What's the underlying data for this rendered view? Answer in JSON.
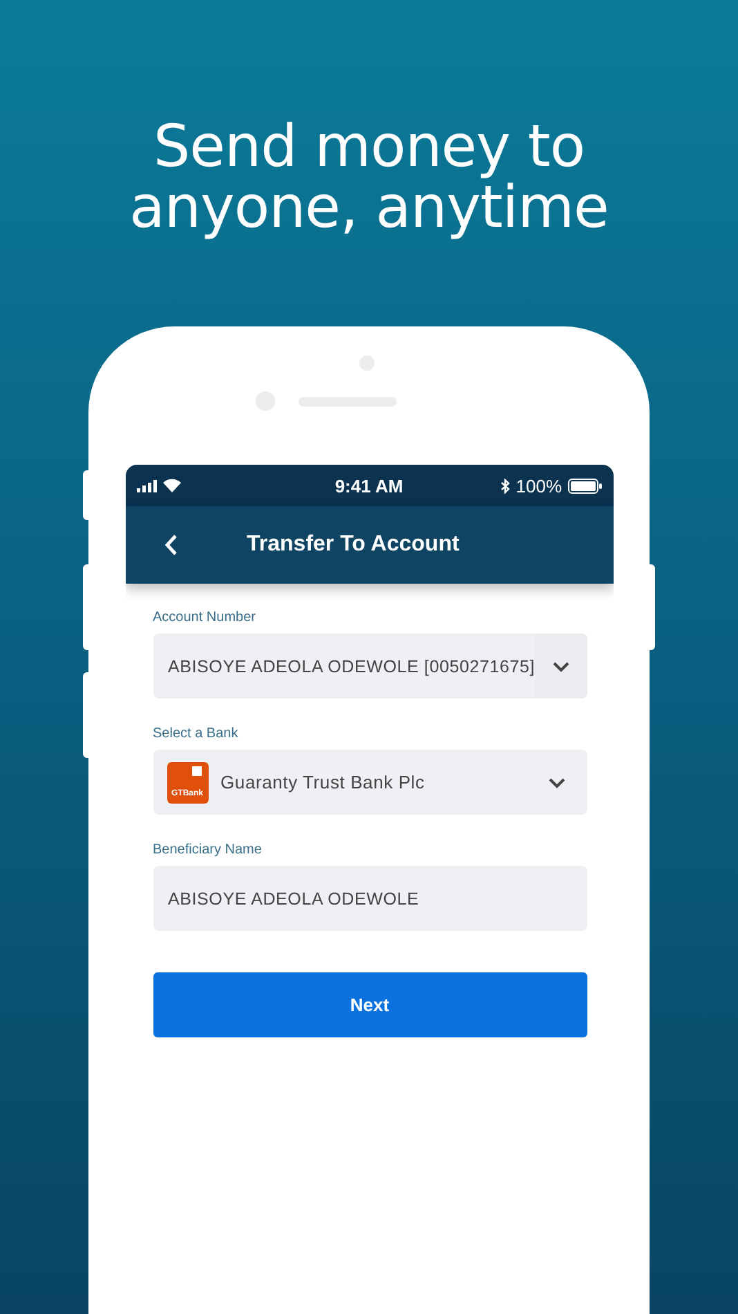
{
  "headline": "Send money to anyone, anytime",
  "status_bar": {
    "time": "9:41 AM",
    "battery": "100%"
  },
  "nav": {
    "title": "Transfer To Account"
  },
  "fields": [
    {
      "kind": "dropdown",
      "label": "Account Number",
      "value": "ABISOYE ADEOLA ODEWOLE [0050271675]"
    },
    {
      "kind": "bank",
      "label": "Select a Bank",
      "value": "Guaranty Trust Bank Plc",
      "logo_text": "GTBank"
    },
    {
      "kind": "text",
      "label": "Beneficiary Name",
      "value": "ABISOYE ADEOLA ODEWOLE"
    }
  ],
  "button": "Next"
}
